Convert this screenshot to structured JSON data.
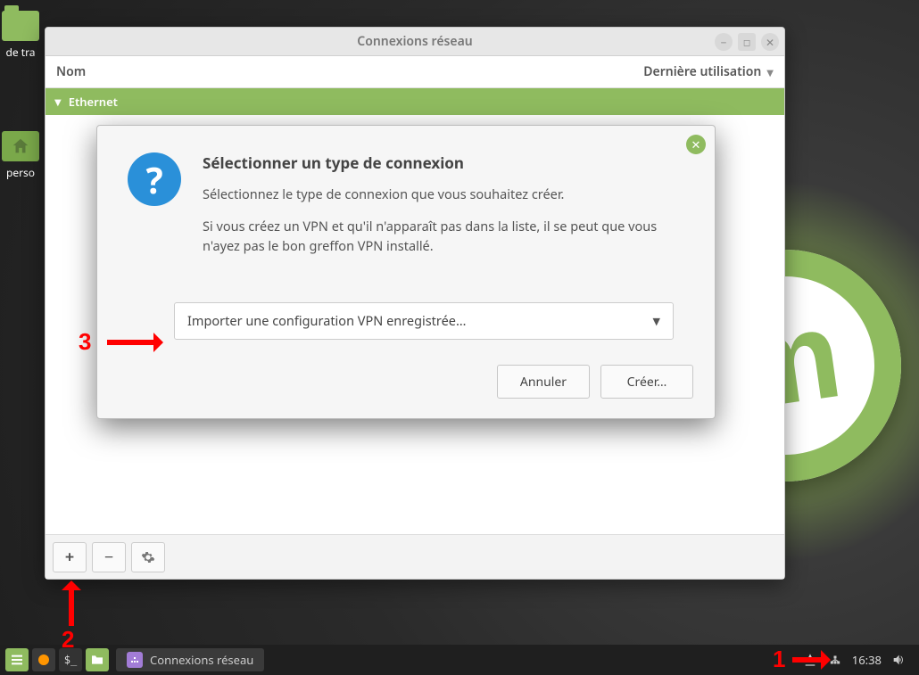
{
  "desktop": {
    "icon1_label": "de tra",
    "icon2_label": "perso"
  },
  "window": {
    "title": "Connexions réseau",
    "col_name": "Nom",
    "col_last": "Dernière utilisation",
    "group1": "Ethernet"
  },
  "dialog": {
    "heading": "Sélectionner un type de connexion",
    "line1": "Sélectionnez le type de connexion que vous souhaitez créer.",
    "line2": "Si vous créez un VPN et qu'il n'apparaît pas dans la liste, il se peut que vous n'ayez pas le bon greffon VPN installé.",
    "combo_value": "Importer une configuration VPN enregistrée…",
    "cancel": "Annuler",
    "create": "Créer…"
  },
  "taskbar": {
    "app_label": "Connexions réseau",
    "clock": "16:38"
  },
  "annotations": {
    "n1": "1",
    "n2": "2",
    "n3": "3"
  }
}
